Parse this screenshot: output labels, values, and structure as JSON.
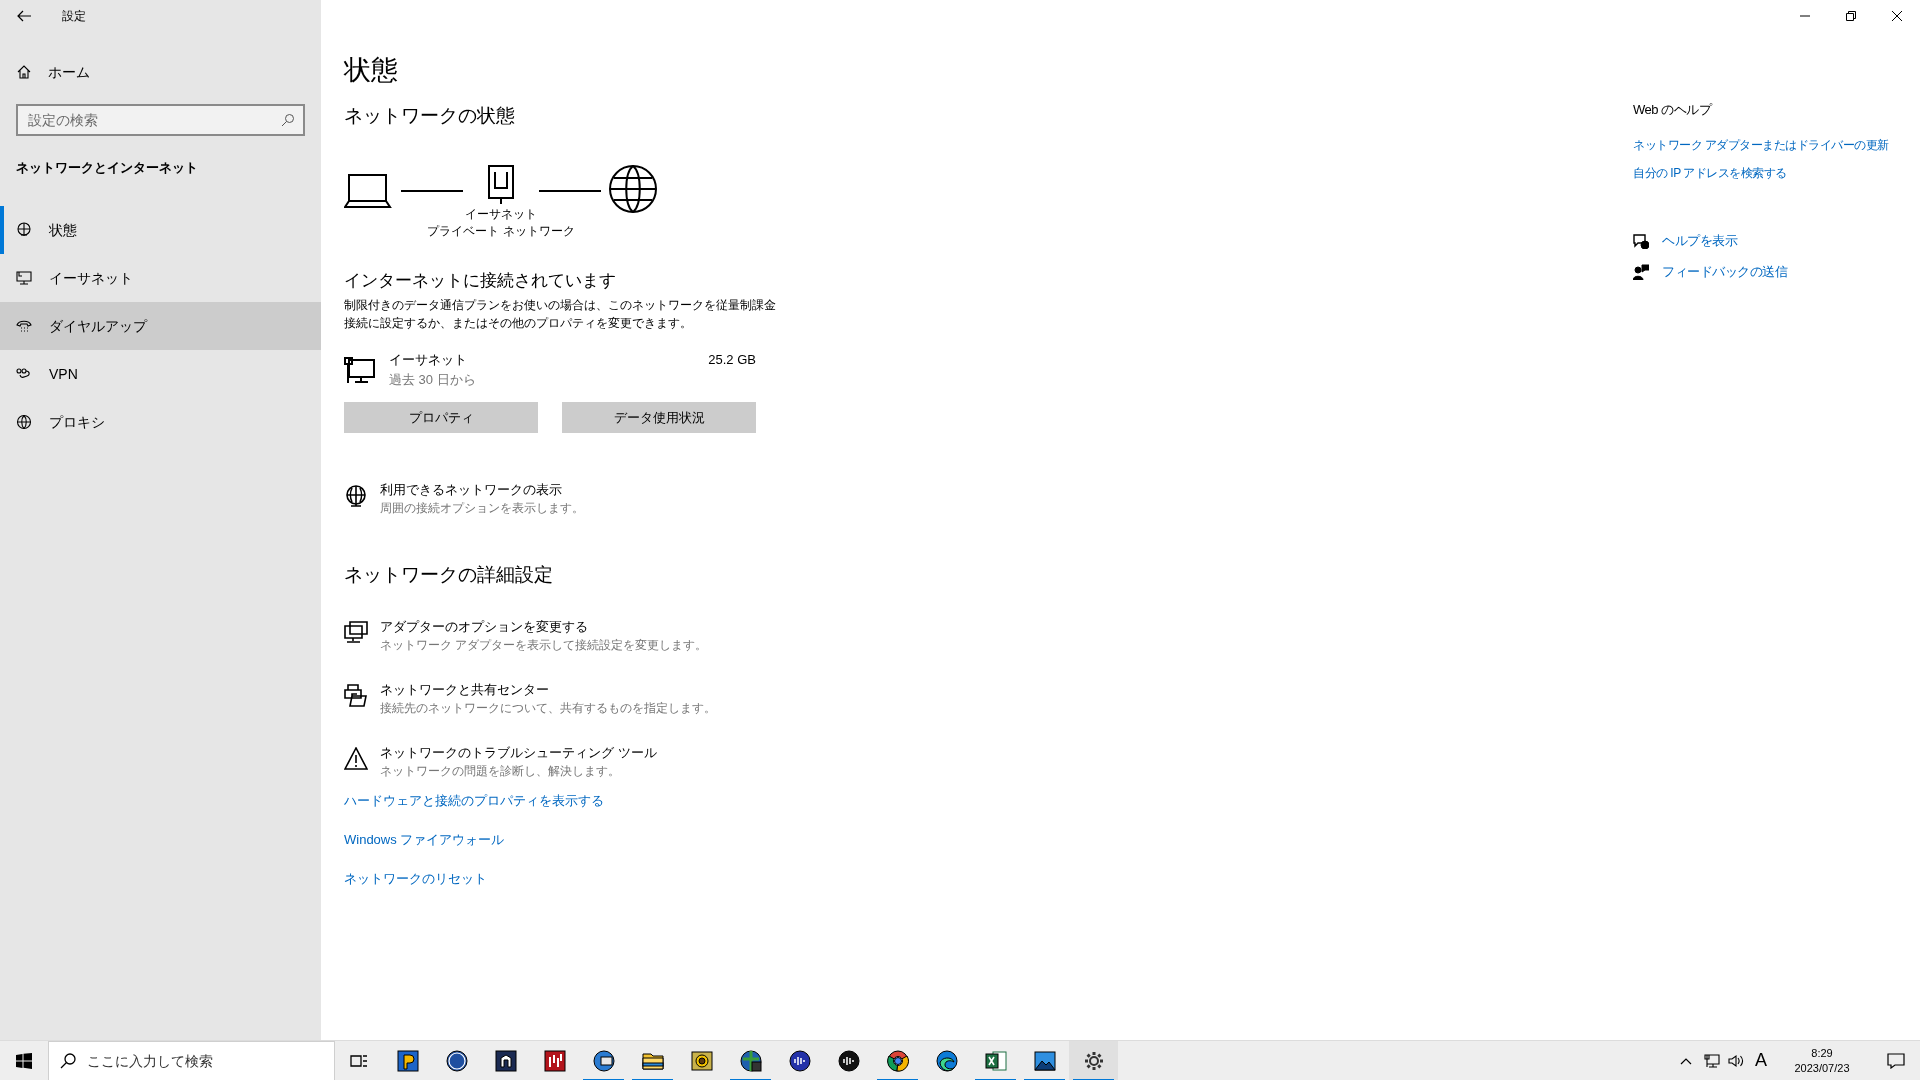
{
  "window": {
    "title": "設定"
  },
  "sidebar": {
    "home": "ホーム",
    "search": {
      "placeholder": "設定の検索"
    },
    "section": "ネットワークとインターネット",
    "items": [
      {
        "label": "状態",
        "selected": true,
        "hovered": false
      },
      {
        "label": "イーサネット",
        "selected": false,
        "hovered": false
      },
      {
        "label": "ダイヤルアップ",
        "selected": false,
        "hovered": true
      },
      {
        "label": "VPN",
        "selected": false,
        "hovered": false
      },
      {
        "label": "プロキシ",
        "selected": false,
        "hovered": false
      }
    ]
  },
  "main": {
    "title": "状態",
    "network_heading": "ネットワークの状態",
    "diagram": {
      "label": "イーサネット",
      "sublabel": "プライベート ネットワーク"
    },
    "connected_heading": "インターネットに接続されています",
    "connected_text": "制限付きのデータ通信プランをお使いの場合は、このネットワークを従量制課金接続に設定するか、またはその他のプロパティを変更できます。",
    "usage": {
      "name": "イーサネット",
      "period": "過去 30 日から",
      "amount": "25.2 GB"
    },
    "buttons": [
      "プロパティ",
      "データ使用状況"
    ],
    "available": {
      "title": "利用できるネットワークの表示",
      "text": "周囲の接続オプションを表示します。"
    },
    "advanced_heading": "ネットワークの詳細設定",
    "advanced_items": [
      {
        "title": "アダプターのオプションを変更する",
        "text": "ネットワーク アダプターを表示して接続設定を変更します。"
      },
      {
        "title": "ネットワークと共有センター",
        "text": "接続先のネットワークについて、共有するものを指定します。"
      },
      {
        "title": "ネットワークのトラブルシューティング ツール",
        "text": "ネットワークの問題を診断し、解決します。"
      }
    ],
    "links": [
      "ハードウェアと接続のプロパティを表示する",
      "Windows ファイアウォール",
      "ネットワークのリセット"
    ]
  },
  "help": {
    "heading": "Web のヘルプ",
    "links": [
      "ネットワーク アダプターまたはドライバーの更新",
      "自分の IP アドレスを検索する"
    ],
    "actions": [
      "ヘルプを表示",
      "フィードバックの送信"
    ]
  },
  "taskbar": {
    "search": {
      "placeholder": "ここに入力して検索"
    },
    "apps": [
      {
        "running": false,
        "active": false
      },
      {
        "running": false,
        "active": false
      },
      {
        "running": false,
        "active": false
      },
      {
        "running": false,
        "active": false
      },
      {
        "running": true,
        "active": false
      },
      {
        "running": true,
        "active": false
      },
      {
        "running": false,
        "active": false
      },
      {
        "running": true,
        "active": false
      },
      {
        "running": false,
        "active": false
      },
      {
        "running": false,
        "active": false
      },
      {
        "running": true,
        "active": false
      },
      {
        "running": false,
        "active": false
      },
      {
        "running": true,
        "active": false
      },
      {
        "running": true,
        "active": false
      },
      {
        "running": true,
        "active": true
      }
    ],
    "ime": "A",
    "time": "8:29",
    "date": "2023/07/23"
  }
}
